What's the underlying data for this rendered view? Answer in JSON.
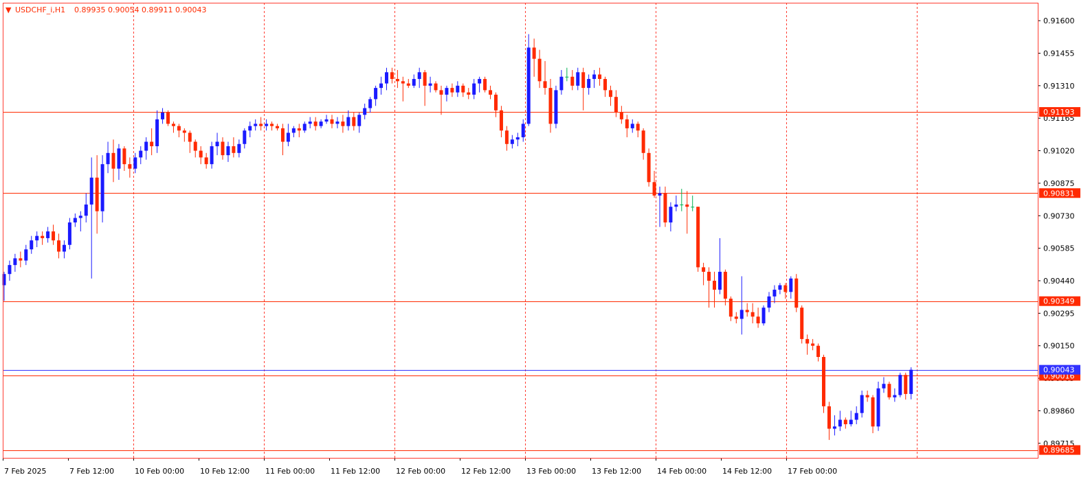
{
  "header": {
    "indicator": "▼",
    "symbol": "USDCHF_i,H1",
    "ohlc": "0.89935 0.90054 0.89911 0.90043"
  },
  "colors": {
    "background": "#ffffff",
    "frame": "#ff3b30",
    "grid": "#ff3b30",
    "bull": "#1a1aff",
    "bear": "#ff2a00",
    "doji": "#00b050",
    "hline": "#ff2a00",
    "bid_line": "#3333ff",
    "tag_fill": "#ff2a00",
    "bid_tag_fill": "#3333ff",
    "axis_text": "#000000"
  },
  "chart_data": {
    "type": "candlestick",
    "symbol": "USDCHF_i",
    "timeframe": "H1",
    "ylim": [
      0.8965,
      0.9168
    ],
    "y_ticks": [
      "0.91600",
      "0.91455",
      "0.91310",
      "0.91165",
      "0.91020",
      "0.90875",
      "0.90730",
      "0.90585",
      "0.90440",
      "0.90295",
      "0.90150",
      "0.90005",
      "0.89860",
      "0.89715"
    ],
    "x_ticks": [
      "7 Feb 2025",
      "7 Feb 12:00",
      "10 Feb 00:00",
      "10 Feb 12:00",
      "11 Feb 00:00",
      "11 Feb 12:00",
      "12 Feb 00:00",
      "12 Feb 12:00",
      "13 Feb 00:00",
      "13 Feb 12:00",
      "14 Feb 00:00",
      "14 Feb 12:00",
      "17 Feb 00:00"
    ],
    "horizontal_levels": [
      {
        "price": "0.91193",
        "value": 0.91193
      },
      {
        "price": "0.90831",
        "value": 0.90831
      },
      {
        "price": "0.90349",
        "value": 0.90349
      },
      {
        "price": "0.90016",
        "value": 0.90016
      },
      {
        "price": "0.89685",
        "value": 0.89685
      }
    ],
    "bid": {
      "price": "0.90043",
      "value": 0.90043
    },
    "last_candle": {
      "open": 0.89935,
      "high": 0.90054,
      "low": 0.89911,
      "close": 0.90043
    },
    "candles": [
      [
        0.9042,
        0.9048,
        0.9035,
        0.9047
      ],
      [
        0.9047,
        0.9053,
        0.9044,
        0.9051
      ],
      [
        0.9051,
        0.9056,
        0.9048,
        0.9054
      ],
      [
        0.9054,
        0.9057,
        0.905,
        0.9053
      ],
      [
        0.9053,
        0.906,
        0.9051,
        0.9058
      ],
      [
        0.9058,
        0.9064,
        0.9056,
        0.9062
      ],
      [
        0.9062,
        0.9066,
        0.9059,
        0.9064
      ],
      [
        0.9064,
        0.9066,
        0.906,
        0.9063
      ],
      [
        0.9063,
        0.9068,
        0.9061,
        0.9066
      ],
      [
        0.9066,
        0.9069,
        0.906,
        0.9062
      ],
      [
        0.9062,
        0.9065,
        0.9054,
        0.9057
      ],
      [
        0.9057,
        0.9062,
        0.9054,
        0.906
      ],
      [
        0.906,
        0.9072,
        0.9058,
        0.907
      ],
      [
        0.907,
        0.9074,
        0.9068,
        0.9072
      ],
      [
        0.9072,
        0.9075,
        0.9066,
        0.9073
      ],
      [
        0.9073,
        0.9083,
        0.907,
        0.9078
      ],
      [
        0.9078,
        0.9099,
        0.9045,
        0.909
      ],
      [
        0.909,
        0.91,
        0.9065,
        0.9075
      ],
      [
        0.9075,
        0.91,
        0.907,
        0.9096
      ],
      [
        0.9096,
        0.9106,
        0.9092,
        0.9101
      ],
      [
        0.9101,
        0.9107,
        0.9088,
        0.9094
      ],
      [
        0.9094,
        0.9105,
        0.9089,
        0.9103
      ],
      [
        0.9103,
        0.9104,
        0.9093,
        0.9096
      ],
      [
        0.9096,
        0.9099,
        0.909,
        0.9094
      ],
      [
        0.9094,
        0.9101,
        0.9092,
        0.9099
      ],
      [
        0.9099,
        0.9104,
        0.9096,
        0.9102
      ],
      [
        0.9102,
        0.9108,
        0.9098,
        0.9106
      ],
      [
        0.9106,
        0.9112,
        0.91,
        0.9104
      ],
      [
        0.9104,
        0.912,
        0.9101,
        0.9116
      ],
      [
        0.9116,
        0.9121,
        0.9114,
        0.9119
      ],
      [
        0.9119,
        0.912,
        0.9113,
        0.9114
      ],
      [
        0.9114,
        0.9115,
        0.911,
        0.9113
      ],
      [
        0.9113,
        0.9114,
        0.9108,
        0.9111
      ],
      [
        0.9111,
        0.9112,
        0.9106,
        0.911
      ],
      [
        0.911,
        0.9111,
        0.9101,
        0.9106
      ],
      [
        0.9106,
        0.9107,
        0.9099,
        0.9102
      ],
      [
        0.9102,
        0.9104,
        0.9096,
        0.9099
      ],
      [
        0.9099,
        0.9101,
        0.9094,
        0.9096
      ],
      [
        0.9096,
        0.9106,
        0.9094,
        0.9104
      ],
      [
        0.9104,
        0.911,
        0.91,
        0.9106
      ],
      [
        0.9106,
        0.9108,
        0.9098,
        0.91
      ],
      [
        0.91,
        0.9106,
        0.9097,
        0.9104
      ],
      [
        0.9104,
        0.9108,
        0.9099,
        0.9101
      ],
      [
        0.9101,
        0.9107,
        0.9099,
        0.9105
      ],
      [
        0.9105,
        0.9112,
        0.9103,
        0.9111
      ],
      [
        0.9111,
        0.9115,
        0.9108,
        0.9113
      ],
      [
        0.9113,
        0.9116,
        0.9111,
        0.9114
      ],
      [
        0.9114,
        0.9117,
        0.9111,
        0.9113
      ],
      [
        0.9113,
        0.9116,
        0.9111,
        0.9114
      ],
      [
        0.9114,
        0.9115,
        0.9111,
        0.9113
      ],
      [
        0.9113,
        0.9114,
        0.9111,
        0.9112
      ],
      [
        0.9112,
        0.9114,
        0.91,
        0.9106
      ],
      [
        0.9106,
        0.9114,
        0.9104,
        0.911
      ],
      [
        0.911,
        0.9113,
        0.9108,
        0.9112
      ],
      [
        0.9112,
        0.9114,
        0.9108,
        0.9111
      ],
      [
        0.9111,
        0.9115,
        0.911,
        0.9114
      ],
      [
        0.9114,
        0.9117,
        0.9112,
        0.9115
      ],
      [
        0.9115,
        0.9117,
        0.9111,
        0.9113
      ],
      [
        0.9113,
        0.9116,
        0.9112,
        0.9115
      ],
      [
        0.9115,
        0.9118,
        0.9114,
        0.9116
      ],
      [
        0.9116,
        0.9118,
        0.9112,
        0.9114
      ],
      [
        0.9114,
        0.9117,
        0.9112,
        0.9115
      ],
      [
        0.9115,
        0.9118,
        0.911,
        0.9113
      ],
      [
        0.9113,
        0.912,
        0.9111,
        0.9117
      ],
      [
        0.9117,
        0.9119,
        0.9111,
        0.9113
      ],
      [
        0.9113,
        0.9119,
        0.911,
        0.9118
      ],
      [
        0.9118,
        0.9123,
        0.9116,
        0.9121
      ],
      [
        0.9121,
        0.9126,
        0.9119,
        0.9125
      ],
      [
        0.9125,
        0.9131,
        0.9122,
        0.913
      ],
      [
        0.913,
        0.9135,
        0.9127,
        0.9132
      ],
      [
        0.9132,
        0.9139,
        0.9129,
        0.9137
      ],
      [
        0.9137,
        0.9139,
        0.9132,
        0.9134
      ],
      [
        0.9134,
        0.9138,
        0.913,
        0.9133
      ],
      [
        0.9133,
        0.9135,
        0.9124,
        0.9132
      ],
      [
        0.9132,
        0.9134,
        0.913,
        0.9131
      ],
      [
        0.9131,
        0.9136,
        0.913,
        0.9134
      ],
      [
        0.9134,
        0.9139,
        0.913,
        0.9137
      ],
      [
        0.9137,
        0.9138,
        0.9122,
        0.9131
      ],
      [
        0.9131,
        0.9135,
        0.9128,
        0.9132
      ],
      [
        0.9132,
        0.9133,
        0.9128,
        0.9129
      ],
      [
        0.9129,
        0.9131,
        0.9118,
        0.9127
      ],
      [
        0.9127,
        0.9131,
        0.9124,
        0.913
      ],
      [
        0.913,
        0.9132,
        0.9126,
        0.9128
      ],
      [
        0.9128,
        0.9133,
        0.9126,
        0.9131
      ],
      [
        0.9131,
        0.9132,
        0.9126,
        0.9128
      ],
      [
        0.9128,
        0.913,
        0.9125,
        0.9127
      ],
      [
        0.9127,
        0.9134,
        0.9125,
        0.9132
      ],
      [
        0.9132,
        0.9135,
        0.9128,
        0.9134
      ],
      [
        0.9134,
        0.9135,
        0.9128,
        0.9129
      ],
      [
        0.9129,
        0.9131,
        0.9125,
        0.9127
      ],
      [
        0.9127,
        0.9128,
        0.9117,
        0.912
      ],
      [
        0.912,
        0.9122,
        0.9108,
        0.9111
      ],
      [
        0.9111,
        0.9113,
        0.9102,
        0.9105
      ],
      [
        0.9105,
        0.9109,
        0.9103,
        0.9107
      ],
      [
        0.9107,
        0.911,
        0.9104,
        0.9108
      ],
      [
        0.9108,
        0.9116,
        0.9106,
        0.9114
      ],
      [
        0.9114,
        0.9154,
        0.9113,
        0.9148
      ],
      [
        0.9148,
        0.9152,
        0.9135,
        0.9143
      ],
      [
        0.9143,
        0.9147,
        0.913,
        0.9133
      ],
      [
        0.9133,
        0.9142,
        0.9127,
        0.913
      ],
      [
        0.913,
        0.9134,
        0.911,
        0.9114
      ],
      [
        0.9114,
        0.9131,
        0.9112,
        0.9129
      ],
      [
        0.9129,
        0.9138,
        0.9127,
        0.9135
      ],
      [
        0.9135,
        0.9139,
        0.9133,
        0.9135
      ],
      [
        0.9135,
        0.9138,
        0.9129,
        0.9131
      ],
      [
        0.9131,
        0.9139,
        0.9129,
        0.9137
      ],
      [
        0.9137,
        0.9139,
        0.912,
        0.913
      ],
      [
        0.913,
        0.9136,
        0.9127,
        0.9134
      ],
      [
        0.9134,
        0.9138,
        0.913,
        0.9136
      ],
      [
        0.9136,
        0.9139,
        0.9131,
        0.9134
      ],
      [
        0.9134,
        0.9135,
        0.9126,
        0.9129
      ],
      [
        0.9129,
        0.9131,
        0.9122,
        0.9126
      ],
      [
        0.9126,
        0.9129,
        0.9117,
        0.9119
      ],
      [
        0.9119,
        0.9122,
        0.9114,
        0.9116
      ],
      [
        0.9116,
        0.9118,
        0.9108,
        0.9112
      ],
      [
        0.9112,
        0.9116,
        0.911,
        0.9114
      ],
      [
        0.9114,
        0.9115,
        0.9108,
        0.9111
      ],
      [
        0.9111,
        0.9112,
        0.9098,
        0.9101
      ],
      [
        0.9101,
        0.9103,
        0.9086,
        0.9088
      ],
      [
        0.9088,
        0.9093,
        0.9081,
        0.9082
      ],
      [
        0.9082,
        0.9086,
        0.9068,
        0.9083
      ],
      [
        0.9083,
        0.9086,
        0.9068,
        0.907
      ],
      [
        0.907,
        0.9079,
        0.9066,
        0.9077
      ],
      [
        0.9077,
        0.9082,
        0.9075,
        0.9078
      ],
      [
        0.9078,
        0.9085,
        0.9075,
        0.9078
      ],
      [
        0.9078,
        0.9084,
        0.9065,
        0.9077
      ],
      [
        0.9077,
        0.9082,
        0.9075,
        0.9077
      ],
      [
        0.9077,
        0.9077,
        0.9048,
        0.905
      ],
      [
        0.905,
        0.9052,
        0.9042,
        0.9048
      ],
      [
        0.9048,
        0.905,
        0.9032,
        0.9044
      ],
      [
        0.9044,
        0.9048,
        0.9032,
        0.904
      ],
      [
        0.904,
        0.9063,
        0.9038,
        0.9048
      ],
      [
        0.9048,
        0.9049,
        0.9033,
        0.9036
      ],
      [
        0.9036,
        0.9037,
        0.9026,
        0.9028
      ],
      [
        0.9028,
        0.903,
        0.9025,
        0.9027
      ],
      [
        0.9027,
        0.9046,
        0.902,
        0.9031
      ],
      [
        0.9031,
        0.9034,
        0.9028,
        0.903
      ],
      [
        0.903,
        0.9034,
        0.9025,
        0.9028
      ],
      [
        0.9028,
        0.9032,
        0.9023,
        0.9025
      ],
      [
        0.9025,
        0.9033,
        0.9024,
        0.9032
      ],
      [
        0.9032,
        0.9039,
        0.903,
        0.9037
      ],
      [
        0.9037,
        0.9042,
        0.9034,
        0.904
      ],
      [
        0.904,
        0.9043,
        0.9038,
        0.9042
      ],
      [
        0.9042,
        0.9043,
        0.9036,
        0.9039
      ],
      [
        0.9039,
        0.9046,
        0.9036,
        0.9045
      ],
      [
        0.9045,
        0.9047,
        0.903,
        0.9032
      ],
      [
        0.9032,
        0.9033,
        0.9016,
        0.9018
      ],
      [
        0.9018,
        0.902,
        0.9011,
        0.9016
      ],
      [
        0.9016,
        0.9018,
        0.9013,
        0.9015
      ],
      [
        0.9015,
        0.9016,
        0.9008,
        0.901
      ],
      [
        0.901,
        0.9011,
        0.8985,
        0.8988
      ],
      [
        0.8988,
        0.899,
        0.8973,
        0.8978
      ],
      [
        0.8978,
        0.8984,
        0.8975,
        0.8979
      ],
      [
        0.8979,
        0.8986,
        0.8977,
        0.8982
      ],
      [
        0.8982,
        0.8983,
        0.8978,
        0.898
      ],
      [
        0.898,
        0.8986,
        0.8979,
        0.8982
      ],
      [
        0.8982,
        0.8988,
        0.898,
        0.8985
      ],
      [
        0.8985,
        0.8995,
        0.8983,
        0.8993
      ],
      [
        0.8993,
        0.8995,
        0.899,
        0.8992
      ],
      [
        0.8992,
        0.8993,
        0.8976,
        0.8979
      ],
      [
        0.8979,
        0.8999,
        0.8977,
        0.8996
      ],
      [
        0.8996,
        0.9001,
        0.8994,
        0.8998
      ],
      [
        0.8998,
        0.8999,
        0.8991,
        0.8992
      ],
      [
        0.8992,
        0.8996,
        0.899,
        0.8993
      ],
      [
        0.8993,
        0.9003,
        0.8992,
        0.9002
      ],
      [
        0.9002,
        0.9003,
        0.8991,
        0.89935
      ],
      [
        0.89935,
        0.90054,
        0.89911,
        0.90043
      ]
    ]
  }
}
